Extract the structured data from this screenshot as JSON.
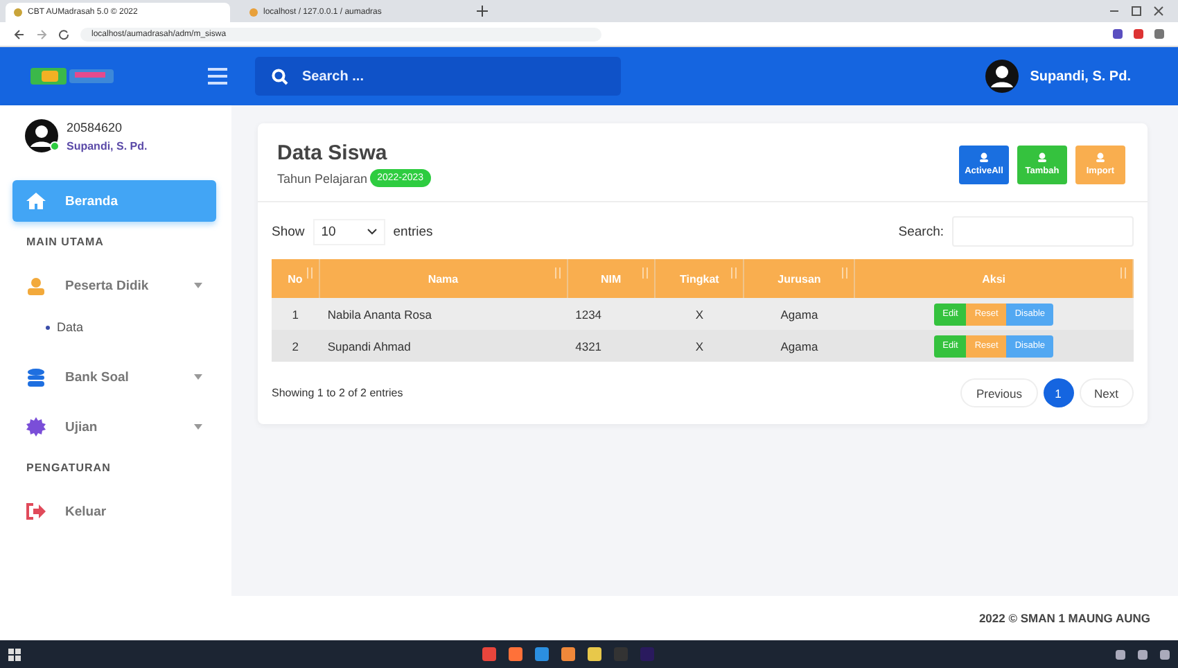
{
  "browser": {
    "tabs": [
      {
        "title": "CBT AUMadrasah 5.0 © 2022",
        "selected": true
      },
      {
        "title": "localhost / 127.0.0.1 / aumadras",
        "selected": false
      }
    ],
    "url": "localhost/aumadrasah/adm/m_siswa"
  },
  "header": {
    "search": {
      "placeholder": "Search ..."
    },
    "user": "Supandi, S. Pd."
  },
  "sidebar": {
    "profile": {
      "id": "20584620",
      "name": "Supandi, S. Pd.",
      "online": true
    },
    "items": [
      {
        "kind": "item",
        "label": "Beranda",
        "selected": true,
        "expandable": false
      },
      {
        "kind": "heading",
        "label": "MAIN UTAMA"
      },
      {
        "kind": "item",
        "label": "Peserta Didik",
        "selected": false,
        "expandable": true
      },
      {
        "kind": "subitem",
        "label": "Data",
        "selected": false
      },
      {
        "kind": "item",
        "label": "Bank Soal",
        "selected": false,
        "expandable": true
      },
      {
        "kind": "item",
        "label": "Ujian",
        "selected": false,
        "expandable": true
      },
      {
        "kind": "heading",
        "label": "PENGATURAN"
      },
      {
        "kind": "item",
        "label": "Keluar",
        "selected": false,
        "expandable": false
      }
    ]
  },
  "main": {
    "title": "Data Siswa",
    "subtitle": "Tahun Pelajaran",
    "badge": "2022-2023",
    "buttons": [
      {
        "kind": "primary",
        "label": "ActiveAll"
      },
      {
        "kind": "success",
        "label": "Tambah"
      },
      {
        "kind": "warning",
        "label": "Import"
      }
    ],
    "length": {
      "before": "Show",
      "value": "10",
      "after": "entries"
    },
    "search_label": "Search:",
    "table": {
      "columns": [
        "No",
        "Nama",
        "NIM",
        "Tingkat",
        "Jurusan",
        "Aksi"
      ],
      "rows": [
        {
          "no": "1",
          "nama": "Nabila Ananta Rosa",
          "nim": "1234",
          "tingkat": "X",
          "jurusan": "Agama",
          "actions": [
            "Edit",
            "Reset",
            "Disable"
          ]
        },
        {
          "no": "2",
          "nama": "Supandi Ahmad",
          "nim": "4321",
          "tingkat": "X",
          "jurusan": "Agama",
          "actions": [
            "Edit",
            "Reset",
            "Disable"
          ]
        }
      ]
    },
    "info": "Showing 1 to 2 of 2 entries",
    "pagination": [
      {
        "label": "Previous",
        "selected": false
      },
      {
        "label": "1",
        "selected": true
      },
      {
        "label": "Next",
        "selected": false
      }
    ]
  },
  "footer": "2022 © SMAN 1 MAUNG AUNG"
}
